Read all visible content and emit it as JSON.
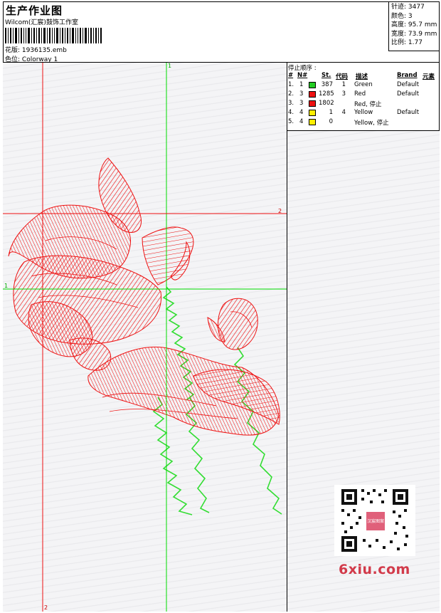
{
  "header": {
    "title": "生产作业图",
    "company": "Wilcom(汇宸)鼓饰工作室",
    "design_label": "花版",
    "design_value": "1936135.emb",
    "colorway_label": "色位",
    "colorway_value": "Colorway 1"
  },
  "stats": [
    {
      "label": "针迹",
      "value": "3477"
    },
    {
      "label": "颜色",
      "value": "3"
    },
    {
      "label": "高度",
      "value": "95.7 mm"
    },
    {
      "label": "宽度",
      "value": "73.9 mm"
    },
    {
      "label": "比例",
      "value": "1.77"
    }
  ],
  "stop_sequence": {
    "title": "停止顺序 :",
    "columns": [
      "#",
      "N#",
      "St.",
      "代码",
      "描述",
      "Brand",
      "元素"
    ],
    "rows": [
      {
        "num": "1.",
        "n": "1",
        "color": "#22cc22",
        "stitches": "387",
        "code": "1",
        "desc": "Green",
        "brand": "Default"
      },
      {
        "num": "2.",
        "n": "3",
        "color": "#ee1111",
        "stitches": "1285",
        "code": "3",
        "desc": "Red",
        "brand": "Default"
      },
      {
        "num": "3.",
        "n": "3",
        "color": "#ee1111",
        "stitches": "1802",
        "code": "",
        "desc": "Red, 停止",
        "brand": ""
      },
      {
        "num": "4.",
        "n": "4",
        "color": "#ffee00",
        "stitches": "1",
        "code": "4",
        "desc": "Yellow",
        "brand": "Default"
      },
      {
        "num": "5.",
        "n": "4",
        "color": "#ffee00",
        "stitches": "0",
        "code": "",
        "desc": "Yellow, 停止",
        "brand": ""
      }
    ]
  },
  "guides": {
    "v1": "1",
    "v2": "2",
    "h1": "1",
    "h2": "2"
  },
  "colors": {
    "red": "#ee1111",
    "green": "#33dd33",
    "guide": "#00dd00"
  },
  "qr_label": "汉宸图案",
  "watermark": "6xiu.com"
}
